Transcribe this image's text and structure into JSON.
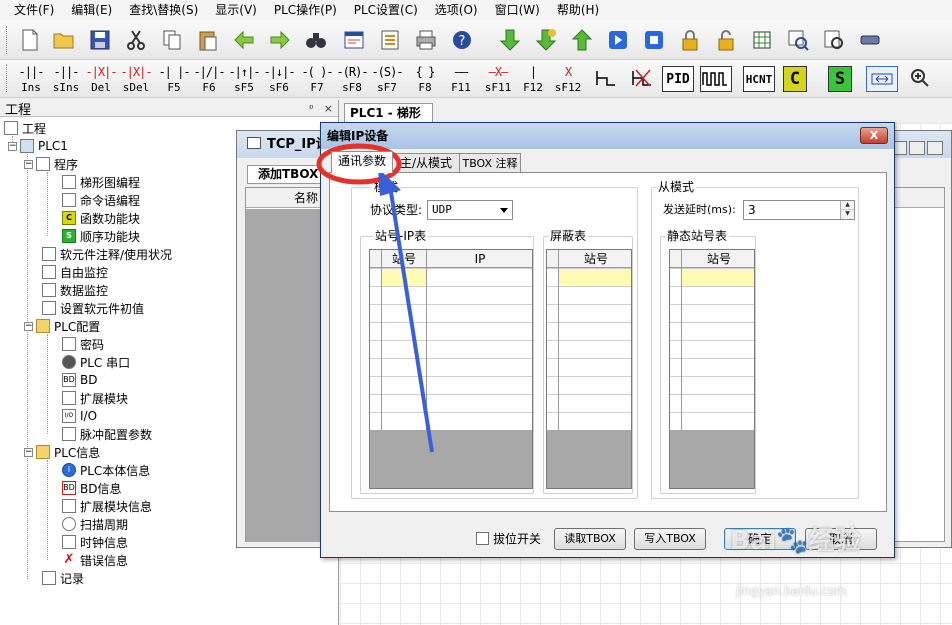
{
  "menu": [
    "文件(F)",
    "编辑(E)",
    "查找\\替换(S)",
    "显示(V)",
    "PLC操作(P)",
    "PLC设置(C)",
    "选项(O)",
    "窗口(W)",
    "帮助(H)"
  ],
  "toolbar2": {
    "ladder_buttons": [
      {
        "sym": "-||-",
        "label": "Ins"
      },
      {
        "sym": "-||-",
        "label": "sIns"
      },
      {
        "sym": "-|X|-",
        "label": "Del"
      },
      {
        "sym": "-|X|-",
        "label": "sDel"
      },
      {
        "sym": "-| |-",
        "label": "F5"
      },
      {
        "sym": "-|/|-",
        "label": "F6"
      },
      {
        "sym": "-|↑|-",
        "label": "sF5"
      },
      {
        "sym": "-|↓|-",
        "label": "sF6"
      },
      {
        "sym": "-( )-",
        "label": "F7"
      },
      {
        "sym": "-(R)-",
        "label": "sF8"
      },
      {
        "sym": "-(S)-",
        "label": "sF7"
      },
      {
        "sym": "{ }",
        "label": "F8"
      },
      {
        "sym": "——",
        "label": "F11"
      },
      {
        "sym": "—X—",
        "label": "sF11"
      },
      {
        "sym": "|",
        "label": "F12"
      },
      {
        "sym": "X",
        "label": "sF12"
      }
    ],
    "pid": "PID",
    "hcnt": "HCNT",
    "c_block": "C",
    "s_block": "S"
  },
  "project_panel": {
    "title": "工程",
    "pin": "ᵖ",
    "close": "×",
    "tree": [
      {
        "label": "工程",
        "icon": "project-icon"
      },
      {
        "label": "PLC1",
        "icon": "plc-icon"
      },
      {
        "label": "程序",
        "icon": "program-icon"
      },
      {
        "label": "梯形图编程",
        "icon": "ladder-icon"
      },
      {
        "label": "命令语编程",
        "icon": "instruction-icon"
      },
      {
        "label": "函数功能块",
        "icon": "function-block-icon",
        "glyph": "C"
      },
      {
        "label": "顺序功能块",
        "icon": "sequence-block-icon",
        "glyph": "S"
      },
      {
        "label": "软元件注释/使用状况",
        "icon": "comment-icon"
      },
      {
        "label": "自由监控",
        "icon": "free-monitor-icon"
      },
      {
        "label": "数据监控",
        "icon": "data-monitor-icon"
      },
      {
        "label": "设置软元件初值",
        "icon": "initial-value-icon"
      },
      {
        "label": "PLC配置",
        "icon": "folder-icon"
      },
      {
        "label": "密码",
        "icon": "password-icon"
      },
      {
        "label": "PLC 串口",
        "icon": "serial-port-icon"
      },
      {
        "label": "BD",
        "icon": "bd-icon",
        "glyph": "BD"
      },
      {
        "label": "扩展模块",
        "icon": "expansion-module-icon"
      },
      {
        "label": "I/O",
        "icon": "io-icon",
        "glyph": "I/O"
      },
      {
        "label": "脉冲配置参数",
        "icon": "pulse-icon"
      },
      {
        "label": "PLC信息",
        "icon": "folder-icon"
      },
      {
        "label": "PLC本体信息",
        "icon": "info-icon",
        "glyph": "i"
      },
      {
        "label": "BD信息",
        "icon": "bd-info-icon",
        "glyph": "BD"
      },
      {
        "label": "扩展模块信息",
        "icon": "expansion-info-icon"
      },
      {
        "label": "扫描周期",
        "icon": "scan-cycle-icon"
      },
      {
        "label": "时钟信息",
        "icon": "clock-icon"
      },
      {
        "label": "错误信息",
        "icon": "error-icon",
        "glyph": "✗"
      },
      {
        "label": "记录",
        "icon": "record-icon"
      }
    ]
  },
  "workspace_tab": "PLC1 - 梯形图",
  "tcp_window": {
    "title": "TCP_IP设",
    "add_tbox": "添加TBOX",
    "col_name": "名称"
  },
  "dialog": {
    "title": "编辑IP设备",
    "close": "X",
    "tabs": [
      "通讯参数",
      "主/从模式",
      "TBOX 注释"
    ],
    "master_group": "模式",
    "protocol_label": "协议类型:",
    "protocol_value": "UDP",
    "ip_table_group": "站号-IP表",
    "ip_table_cols": [
      "站号",
      "IP"
    ],
    "shield_group": "屏蔽表",
    "shield_col": "站号",
    "slave_group": "从模式",
    "delay_label": "发送延时(ms):",
    "delay_value": "3",
    "static_group": "静态站号表",
    "static_col": "站号",
    "dip_switch": "拔位开关",
    "btn_read": "读取TBOX",
    "btn_write": "写入TBOX",
    "btn_ok": "确定",
    "btn_cancel": "取消"
  },
  "watermark": {
    "brand": "Bai🐾经验",
    "url": "jingyan.baidu.com"
  },
  "colors": {
    "annotation_red": "#e8302a",
    "annotation_blue": "#3a5fd8",
    "selected_cell": "#fffbb4"
  }
}
